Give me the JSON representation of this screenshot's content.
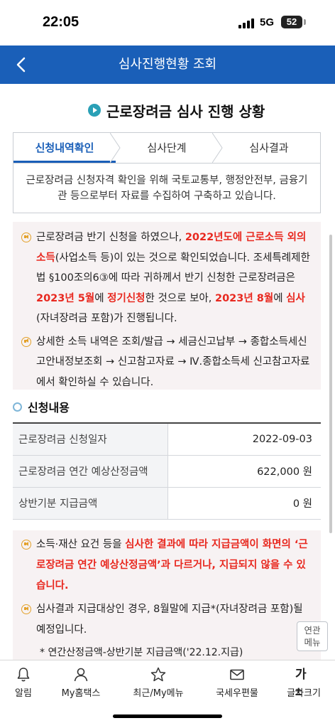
{
  "status": {
    "time": "22:05",
    "network": "5G",
    "battery": "52"
  },
  "header": {
    "title": "심사진행현황 조회"
  },
  "section": {
    "title": "근로장려금 심사 진행 상황"
  },
  "tabs": [
    {
      "label": "신청내역확인"
    },
    {
      "label": "심사단계"
    },
    {
      "label": "심사결과"
    }
  ],
  "tab_description": "근로장려금 신청자격 확인을 위해 국토교통부, 행정안전부, 금융기관 등으로부터 자료를 수집하여 구축하고 있습니다.",
  "notice": {
    "item1": {
      "p1": "근로장려금 반기 신청을 하였으나, ",
      "r1": "2022년도에 근로소득 외의 소득",
      "p2": "(사업소득 등)이 있는 것으로 확인되었습니다. 조세특례제한법 §100조의6③에 따라 귀하께서 반기 신청한 근로장려금은 ",
      "r2": "2023년 5월",
      "p3": "에 ",
      "r3": "정기신청",
      "p4": "한 것으로 보아, ",
      "r4": "2023년 8월",
      "p5": "에 ",
      "r5": "심사",
      "p6": "(자녀장려금 포함)가 진행됩니다."
    },
    "item2": "상세한 소득 내역은 조회/발급 → 세금신고납부 → 종합소득세신고안내정보조회 → 신고참고자료 → Ⅳ.종합소득세 신고참고자료에서 확인하실 수 있습니다."
  },
  "application": {
    "title": "신청내용",
    "rows": [
      {
        "label": "근로장려금 신청일자",
        "value": "2022-09-03"
      },
      {
        "label": "근로장려금 연간 예상산정금액",
        "value": "622,000 원"
      },
      {
        "label": "상반기분 지급금액",
        "value": "0 원"
      }
    ]
  },
  "notice2": {
    "item1": {
      "p1": "소득·재산 요건 등을 ",
      "r1": "심사한 결과에 따라 지급금액이 화면의 ‘근로장려금 연간 예상산정금액’과 다르거나, 지급되지 않을 수 있습니다."
    },
    "item2": "심사결과 지급대상인 경우, 8월말에 지급*(자녀장려금 포함)될 예정입니다.",
    "note": "* 연간산정금액-상반기분 지급금액('22.12.지급)"
  },
  "related_button": {
    "line1": "연관",
    "line2": "메뉴"
  },
  "bottom_nav": [
    {
      "label": "알림",
      "icon": "bell-icon"
    },
    {
      "label": "My홈택스",
      "icon": "person-icon"
    },
    {
      "label": "최근/My메뉴",
      "icon": "star-icon"
    },
    {
      "label": "국세우편물",
      "icon": "mail-icon"
    },
    {
      "label": "글자크기",
      "icon": "font-size-icon",
      "glyph": "가±"
    }
  ],
  "colors": {
    "header": "#1a5fb8",
    "highlight": "#e8281f",
    "notice_bg": "#f7f2f3"
  }
}
